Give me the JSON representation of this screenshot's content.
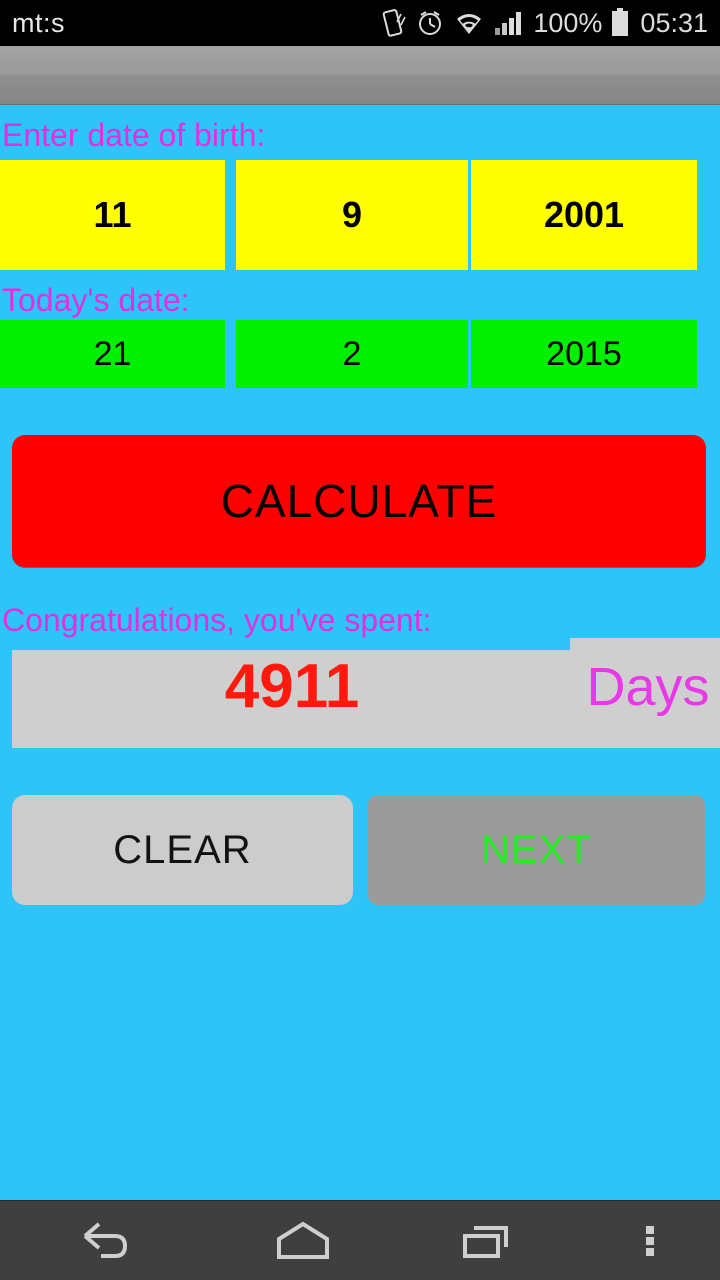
{
  "statusbar": {
    "label": "mt:s",
    "battery_percent": "100%",
    "clock": "05:31",
    "icons": [
      "vibrate-icon",
      "alarm-clock-icon",
      "wifi-icon",
      "signal-bars-icon",
      "battery-icon"
    ]
  },
  "app": {
    "dob": {
      "label": "Enter date of birth:",
      "day": "11",
      "month": "9",
      "year": "2001"
    },
    "today": {
      "label": "Today's date:",
      "day": "21",
      "month": "2",
      "year": "2015"
    },
    "calculate_button": "CALCULATE",
    "result": {
      "label": "Congratulations, you've spent:",
      "value": "4911",
      "unit": "Days"
    },
    "clear_button": "CLEAR",
    "next_button": "NEXT"
  },
  "navbar": {
    "back": "back-icon",
    "home": "home-icon",
    "recents": "recents-icon",
    "menu": "overflow-menu-icon"
  },
  "colors": {
    "background": "#2ec4f7",
    "label_magenta": "#e030e0",
    "dob_field": "#ffff00",
    "today_field": "#00f000",
    "calculate": "#ff0000",
    "result_panel": "#cfcfcf",
    "result_number": "#ff1a0d",
    "result_unit": "#e838e8",
    "clear_button": "#cccccc",
    "next_button": "#9b9b9b",
    "next_text": "#22ee22",
    "navbar": "#3f3f3f"
  }
}
